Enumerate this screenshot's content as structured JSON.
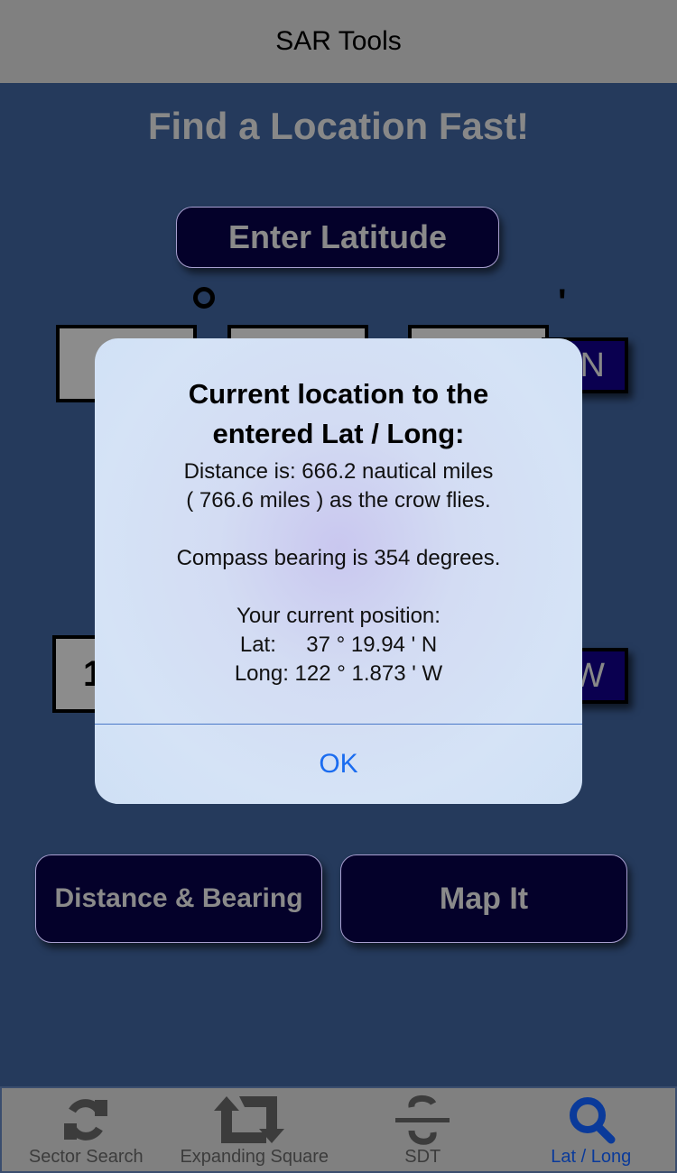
{
  "navbar": {
    "title": "SAR Tools"
  },
  "main": {
    "headline": "Find a Location Fast!",
    "enter_latitude_label": "Enter Latitude",
    "degree_symbol": "°",
    "minute_symbol": "'",
    "lat_fields": {
      "degrees": "",
      "minutes": "",
      "seconds": ""
    },
    "lat_hemisphere": "N",
    "long_fields": {
      "degrees": "1"
    },
    "long_hemisphere": "W",
    "distance_bearing_label": "Distance & Bearing",
    "map_it_label": "Map It"
  },
  "alert": {
    "title_line1": "Current location to the",
    "title_line2": "entered Lat / Long:",
    "distance_line1": "Distance is: 666.2 nautical miles",
    "distance_line2": "( 766.6 miles ) as the crow flies.",
    "bearing_line": "Compass bearing is 354 degrees.",
    "position_header": "Your current position:",
    "position_lat": "Lat:     37 ° 19.94 ' N",
    "position_long": "Long: 122 ° 1.873 ' W",
    "ok_label": "OK"
  },
  "tabbar": {
    "tabs": [
      {
        "label": "Sector Search",
        "icon": "refresh-icon",
        "active": false
      },
      {
        "label": "Expanding Square",
        "icon": "retweet-icon",
        "active": false
      },
      {
        "label": "SDT",
        "icon": "sdt-fraction-icon",
        "active": false
      },
      {
        "label": "Lat / Long",
        "icon": "search-icon",
        "active": true
      }
    ]
  },
  "colors": {
    "background": "#253a5c",
    "bar": "#808080",
    "button_dark": "#04012a",
    "active_tab": "#0a3a9a",
    "alert_ok": "#1a6cf0"
  }
}
